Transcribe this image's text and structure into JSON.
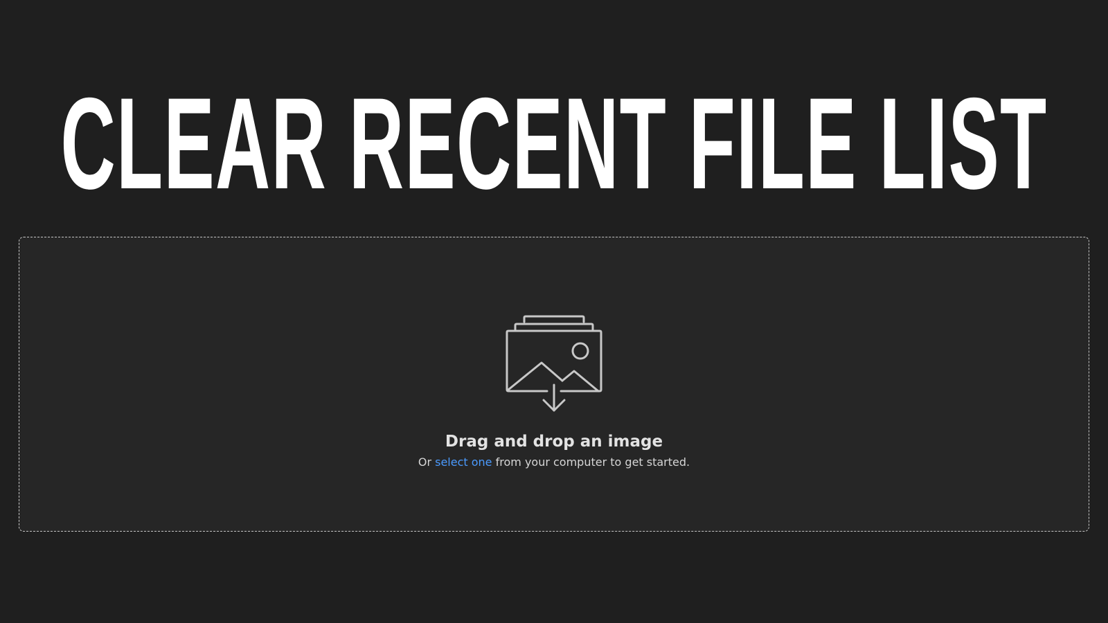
{
  "headline": "CLEAR RECENT FILE LIST",
  "dropzone": {
    "icon": "image-upload-icon",
    "title": "Drag and drop an image",
    "subtitle_prefix": "Or",
    "select_link": "select one",
    "subtitle_suffix": "from your computer to get started."
  },
  "colors": {
    "background": "#1f1f1f",
    "dropzone_background": "#262626",
    "link": "#4b9bff",
    "icon": "#c8c8c8"
  }
}
